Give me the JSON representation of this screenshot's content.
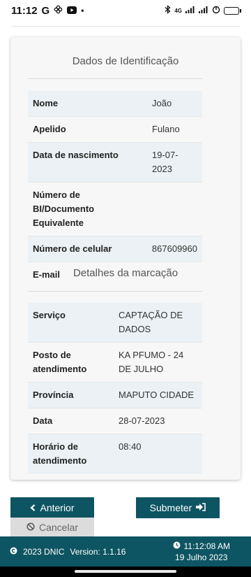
{
  "status_bar": {
    "time": "11:12",
    "network": "4G"
  },
  "identification": {
    "title": "Dados de Identificação",
    "rows": [
      {
        "label": "Nome",
        "value": "João"
      },
      {
        "label": "Apelido",
        "value": "Fulano"
      },
      {
        "label": "Data de nascimento",
        "value": "19-07-2023"
      },
      {
        "label": "Número de BI/Documento Equivalente",
        "value": ""
      },
      {
        "label": "Número de celular",
        "value": "867609960"
      },
      {
        "label": "E-mail",
        "value": ""
      }
    ]
  },
  "appointment": {
    "title": "Detalhes da marcação",
    "rows": [
      {
        "label": "Serviço",
        "value": "CAPTAÇÃO DE DADOS"
      },
      {
        "label": "Posto de atendimento",
        "value": "KA PFUMO - 24 DE JULHO"
      },
      {
        "label": "Província",
        "value": "MAPUTO CIDADE"
      },
      {
        "label": "Data",
        "value": "28-07-2023"
      },
      {
        "label": "Horário de atendimento",
        "value": "08:40"
      }
    ]
  },
  "buttons": {
    "previous": "Anterior",
    "submit": "Submeter",
    "cancel": "Cancelar"
  },
  "footer": {
    "copyright": "2023 DNIC",
    "version": "Version: 1.1.16",
    "time": "11:12:08 AM",
    "date": "19 Julho 2023"
  },
  "colors": {
    "primary": "#0e5563",
    "row_alt": "#ebf1f4",
    "cancel_bg": "#dcdcdc"
  }
}
